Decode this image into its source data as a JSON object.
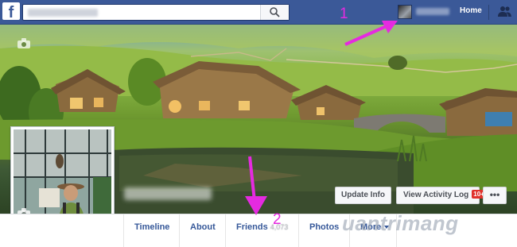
{
  "topbar": {
    "logo": "f",
    "home_label": "Home",
    "icons": [
      "search-icon",
      "friend-requests-icon"
    ]
  },
  "cover": {
    "buttons": {
      "update_info": "Update Info",
      "activity_log": "View Activity Log",
      "activity_badge": "10+",
      "more": "•••"
    }
  },
  "tabs": [
    {
      "label": "Timeline"
    },
    {
      "label": "About"
    },
    {
      "label": "Friends",
      "count": "4,073"
    },
    {
      "label": "Photos"
    },
    {
      "label": "More"
    }
  ],
  "annotations": [
    "1",
    "2"
  ],
  "watermark": "uantrimang",
  "colors": {
    "topbar": "#3b5998",
    "link": "#365899",
    "annotation": "#e52ae0",
    "badge": "#e0312b"
  }
}
